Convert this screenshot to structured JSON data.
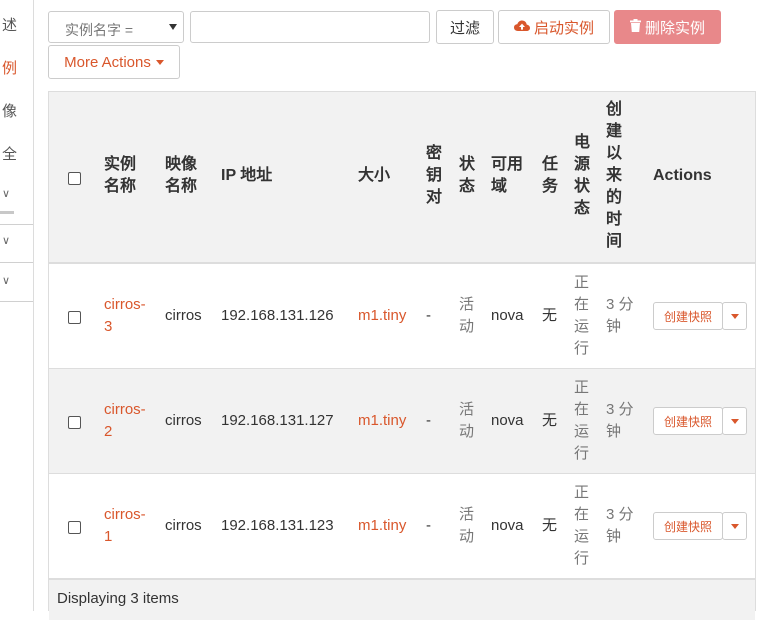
{
  "sidebar": {
    "items": [
      {
        "label": "述"
      },
      {
        "label": "例"
      },
      {
        "label": "像"
      },
      {
        "label": "全"
      }
    ]
  },
  "toolbar": {
    "filter_select_value": "实例名字 =",
    "filter_input_placeholder": "",
    "filter_button": "过滤",
    "launch_button": "启动实例",
    "delete_button": "删除实例",
    "more_actions": "More Actions"
  },
  "table": {
    "headers": {
      "name": "实例名称",
      "image": "映像名称",
      "ip": "IP 地址",
      "size": "大小",
      "keypair": "密钥对",
      "status": "状态",
      "az": "可用域",
      "task": "任务",
      "power": "电源状态",
      "age": "创建以来的时间",
      "actions": "Actions"
    },
    "rows": [
      {
        "name": "cirros-3",
        "image": "cirros",
        "ip": "192.168.131.126",
        "size": "m1.tiny",
        "keypair": "-",
        "status": "活动",
        "az": "nova",
        "task": "无",
        "power": "正在运行",
        "age": "3 分钟",
        "action": "创建快照"
      },
      {
        "name": "cirros-2",
        "image": "cirros",
        "ip": "192.168.131.127",
        "size": "m1.tiny",
        "keypair": "-",
        "status": "活动",
        "az": "nova",
        "task": "无",
        "power": "正在运行",
        "age": "3 分钟",
        "action": "创建快照"
      },
      {
        "name": "cirros-1",
        "image": "cirros",
        "ip": "192.168.131.123",
        "size": "m1.tiny",
        "keypair": "-",
        "status": "活动",
        "az": "nova",
        "task": "无",
        "power": "正在运行",
        "age": "3 分钟",
        "action": "创建快照"
      }
    ],
    "footer": "Displaying 3 items"
  },
  "colors": {
    "accent": "#d9572c",
    "danger_disabled": "#e8888a"
  }
}
